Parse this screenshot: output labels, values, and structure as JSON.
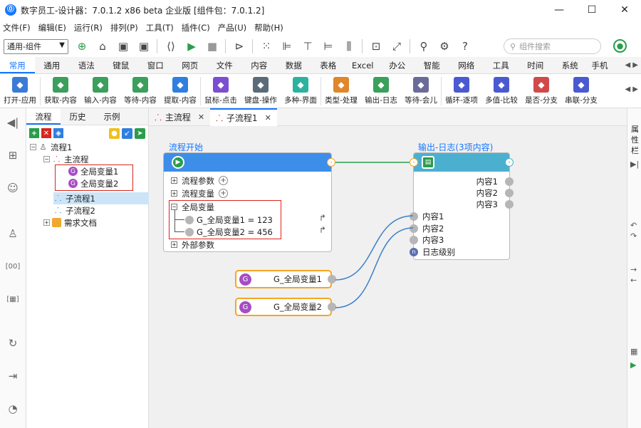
{
  "window": {
    "title": "数字员工-设计器：7.0.1.2 x86 beta 企业版 [组件包：7.0.1.2]",
    "logo": "⓪"
  },
  "menu": [
    "文件(F)",
    "编辑(E)",
    "运行(R)",
    "排列(P)",
    "工具(T)",
    "插件(C)",
    "产品(U)",
    "帮助(H)"
  ],
  "toolbar": {
    "combo_value": "通用-组件",
    "search_placeholder": "组件搜索"
  },
  "tabs": [
    "常用",
    "通用",
    "语法",
    "键鼠",
    "窗口",
    "网页",
    "文件",
    "内容",
    "数据",
    "表格",
    "Excel",
    "办公",
    "智能",
    "网络",
    "工具",
    "时间",
    "系统",
    "手机"
  ],
  "ribbon": [
    {
      "label": "打开-应用",
      "color": "#3a7bd5",
      "icon": "app-icon"
    },
    {
      "label": "获取-内容",
      "color": "#3aa05c",
      "icon": "get-icon"
    },
    {
      "label": "输入-内容",
      "color": "#3aa05c",
      "icon": "input-icon"
    },
    {
      "label": "等待-内容",
      "color": "#3aa05c",
      "icon": "hourglass-icon"
    },
    {
      "label": "提取-内容",
      "color": "#2f7fe0",
      "icon": "extract-icon"
    },
    {
      "label": "鼠标-点击",
      "color": "#7b4fd0",
      "icon": "mouse-icon"
    },
    {
      "label": "键盘-操作",
      "color": "#5a6b7a",
      "icon": "keyboard-icon"
    },
    {
      "label": "多种-界面",
      "color": "#2bb3a0",
      "icon": "multi-ui-icon"
    },
    {
      "label": "类型-处理",
      "color": "#e0862b",
      "icon": "type-icon"
    },
    {
      "label": "输出-日志",
      "color": "#3aa05c",
      "icon": "log-icon"
    },
    {
      "label": "等待-会儿",
      "color": "#6b6b9a",
      "icon": "wait-icon"
    },
    {
      "label": "循环-逐项",
      "color": "#4a5ad0",
      "icon": "loop-icon"
    },
    {
      "label": "多值-比较",
      "color": "#4a5ad0",
      "icon": "compare-icon"
    },
    {
      "label": "是否-分支",
      "color": "#d04a4a",
      "icon": "branch-icon"
    },
    {
      "label": "串联-分支",
      "color": "#4a5ad0",
      "icon": "serial-icon"
    }
  ],
  "left_strip_icons": [
    "collapse-icon",
    "grid-icon",
    "users-icon",
    "robot-icon",
    "ocr-icon",
    "qr-icon",
    "refresh-icon",
    "export-icon",
    "history-icon"
  ],
  "panel": {
    "tabs": [
      "流程",
      "历史",
      "示例"
    ],
    "tree": {
      "root": "流程1",
      "main": "主流程",
      "var1": "全局变量1",
      "var2": "全局变量2",
      "sub1": "子流程1",
      "sub2": "子流程2",
      "docs": "需求文档"
    }
  },
  "doc_tabs": [
    {
      "label": "主流程"
    },
    {
      "label": "子流程1"
    }
  ],
  "right_strip": {
    "label": "属性栏"
  },
  "canvas": {
    "start_node": {
      "title": "流程开始",
      "rows": {
        "params": "流程参数",
        "vars": "流程变量",
        "globals": "全局变量",
        "g1": "G_全局变量1 = 123",
        "g2": "G_全局变量2 = 456",
        "external": "外部参数"
      }
    },
    "log_node": {
      "title": "输出-日志(3项内容)",
      "outputs": [
        "内容1",
        "内容2",
        "内容3"
      ],
      "inputs": [
        "内容1",
        "内容2",
        "内容3",
        "日志级别"
      ]
    },
    "global_nodes": [
      "G_全局变量1",
      "G_全局变量2"
    ]
  },
  "colors": {
    "accent": "#1677ff",
    "highlight": "#d9251d",
    "start_head": "#3d8ee8",
    "log_head": "#4bb0d0"
  }
}
